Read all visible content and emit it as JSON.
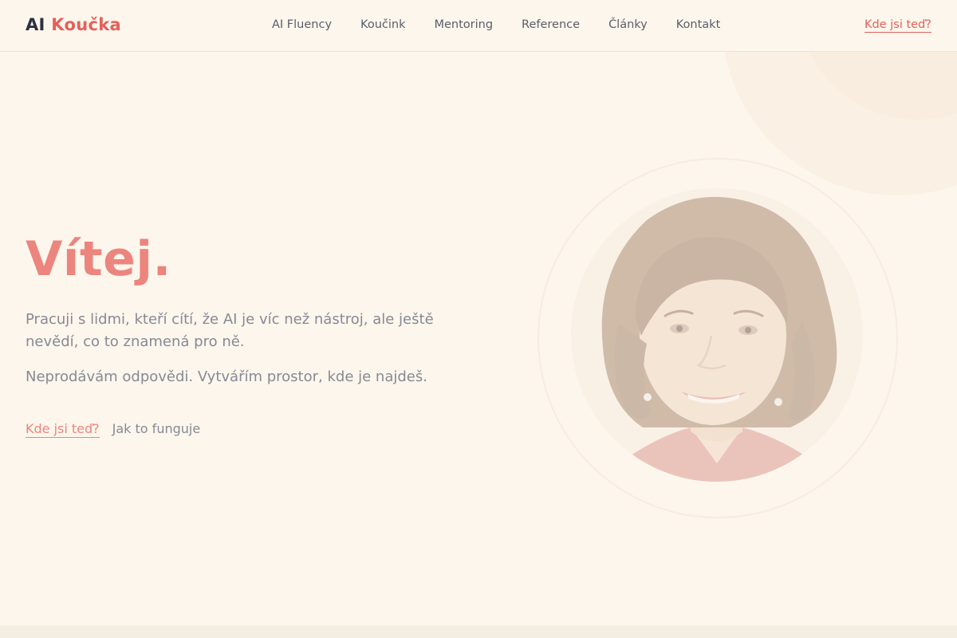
{
  "header": {
    "logo_part1": "AI",
    "logo_part2": "Koučka",
    "nav": [
      {
        "label": "AI Fluency"
      },
      {
        "label": "Koučink"
      },
      {
        "label": "Mentoring"
      },
      {
        "label": "Reference"
      },
      {
        "label": "Články"
      },
      {
        "label": "Kontakt"
      }
    ],
    "cta_label": "Kde jsi teď?"
  },
  "hero": {
    "title": "Vítej.",
    "paragraph1": "Pracuji s lidmi, kteří cítí, že AI je víc než nástroj, ale ještě nevědí, co to znamená pro ně.",
    "paragraph2": "Neprodávám odpovědi. Vytvářím prostor, kde je najdeš.",
    "primary_cta": "Kde jsi teď?",
    "secondary_link": "Jak to funguje"
  },
  "colors": {
    "background": "#fdf6ec",
    "accent": "#e4605a",
    "accent_soft": "#ec857e",
    "text_dark": "#2c3142",
    "text_muted": "#868a95"
  },
  "icons": {
    "portrait": "portrait-photo"
  }
}
